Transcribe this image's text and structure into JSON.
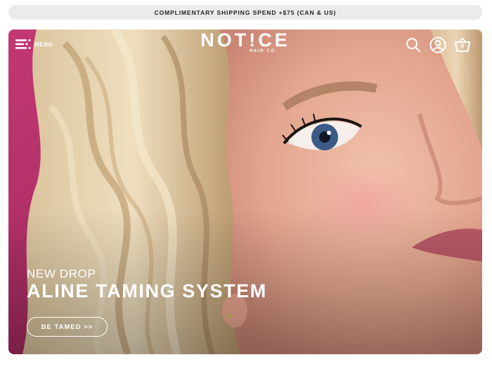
{
  "announcement": {
    "text": "COMPLIMENTARY SHIPPING SPEND +$75 (CAN & US)"
  },
  "header": {
    "menu_label": "MENU",
    "logo_word": "NOT!CE",
    "logo_sub": "HAIR CO.",
    "cart_count": "0",
    "icons": [
      "menu-icon",
      "search-icon",
      "account-icon",
      "cart-icon"
    ]
  },
  "hero": {
    "eyebrow": "NEW DROP",
    "headline": "ALINE TAMING SYSTEM",
    "cta_label": "BE TAMED >>"
  },
  "colors": {
    "backdrop": "#b32a66",
    "announcement_bg": "#ebebeb",
    "text_light": "#ffffff"
  }
}
